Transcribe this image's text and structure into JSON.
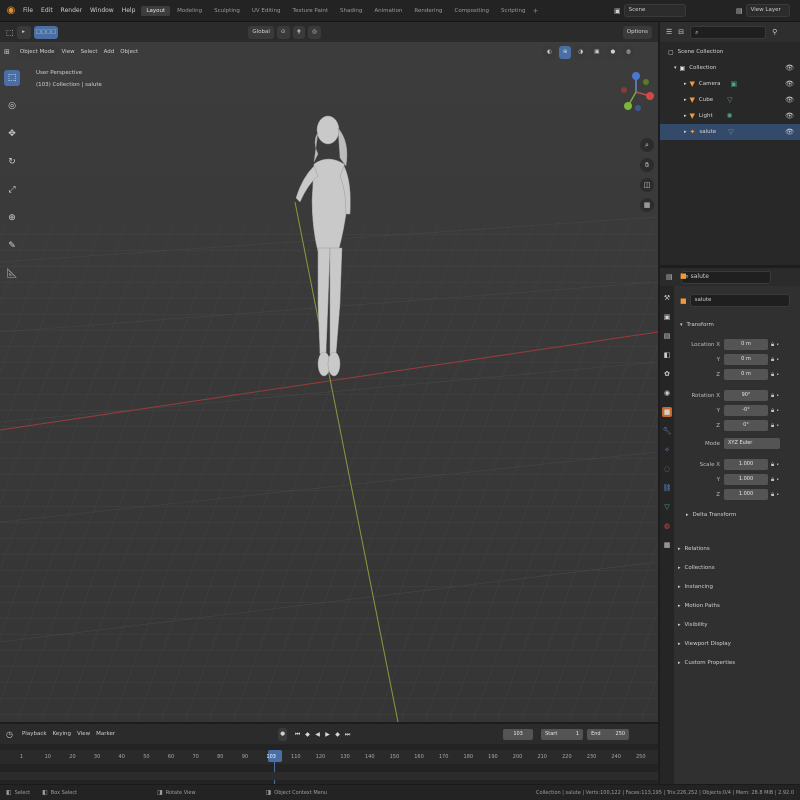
{
  "topbar": {
    "menus": [
      "File",
      "Edit",
      "Render",
      "Window",
      "Help"
    ],
    "workspaces": [
      "Layout",
      "Modeling",
      "Sculpting",
      "UV Editing",
      "Texture Paint",
      "Shading",
      "Animation",
      "Rendering",
      "Compositing",
      "Scripting"
    ],
    "active_workspace": "Layout",
    "scene": "Scene",
    "view_layer": "View Layer"
  },
  "viewport": {
    "mode": "Object Mode",
    "menus": [
      "View",
      "Select",
      "Add",
      "Object"
    ],
    "orientation": "Global",
    "options": "Options",
    "overlay_line1": "User Perspective",
    "overlay_line2": "(103) Collection | salute"
  },
  "outliner": {
    "root": "Scene Collection",
    "collection": "Collection",
    "items": [
      {
        "name": "Camera",
        "icon": "camera-icon",
        "color": "#f09a3c"
      },
      {
        "name": "Cube",
        "icon": "mesh-icon",
        "color": "#f09a3c"
      },
      {
        "name": "Light",
        "icon": "light-icon",
        "color": "#f09a3c"
      },
      {
        "name": "salute",
        "icon": "armature-icon",
        "color": "#f09a3c"
      }
    ]
  },
  "properties": {
    "object_name": "salute",
    "object_field": "salute",
    "transform_title": "Transform",
    "location_label": "Location X",
    "location": [
      "0 m",
      "0 m",
      "0 m"
    ],
    "rotation_label": "Rotation X",
    "rotation": [
      "90°",
      "-0°",
      "0°"
    ],
    "mode_label": "Mode",
    "mode_value": "XYZ Euler",
    "scale_label": "Scale X",
    "scale": [
      "1.000",
      "1.000",
      "1.000"
    ],
    "axis_y": "Y",
    "axis_z": "Z",
    "delta": "Delta Transform",
    "panels": [
      "Relations",
      "Collections",
      "Instancing",
      "Motion Paths",
      "Visibility",
      "Viewport Display",
      "Custom Properties"
    ]
  },
  "timeline": {
    "menus": [
      "Playback",
      "Keying",
      "View",
      "Marker"
    ],
    "current_frame": "103",
    "start_label": "Start",
    "start": "1",
    "end_label": "End",
    "end": "250",
    "ticks": [
      "1",
      "10",
      "20",
      "30",
      "40",
      "50",
      "60",
      "70",
      "80",
      "90",
      "103",
      "110",
      "120",
      "130",
      "140",
      "150",
      "160",
      "170",
      "180",
      "190",
      "200",
      "210",
      "220",
      "230",
      "240",
      "250"
    ]
  },
  "status": {
    "left": [
      "Select",
      "Box Select",
      "Rotate View",
      "Object Context Menu"
    ],
    "right": "Collection | salute | Verts:100,122 | Faces:113,195 | Tris:226,252 | Objects:0/4 | Mem: 28.8 MiB | 2.92.0"
  },
  "colors": {
    "accent": "#4a6fa5",
    "grid": "#4a4a4a",
    "x_axis": "#9a3b3b",
    "y_axis": "#8a9a3b"
  }
}
